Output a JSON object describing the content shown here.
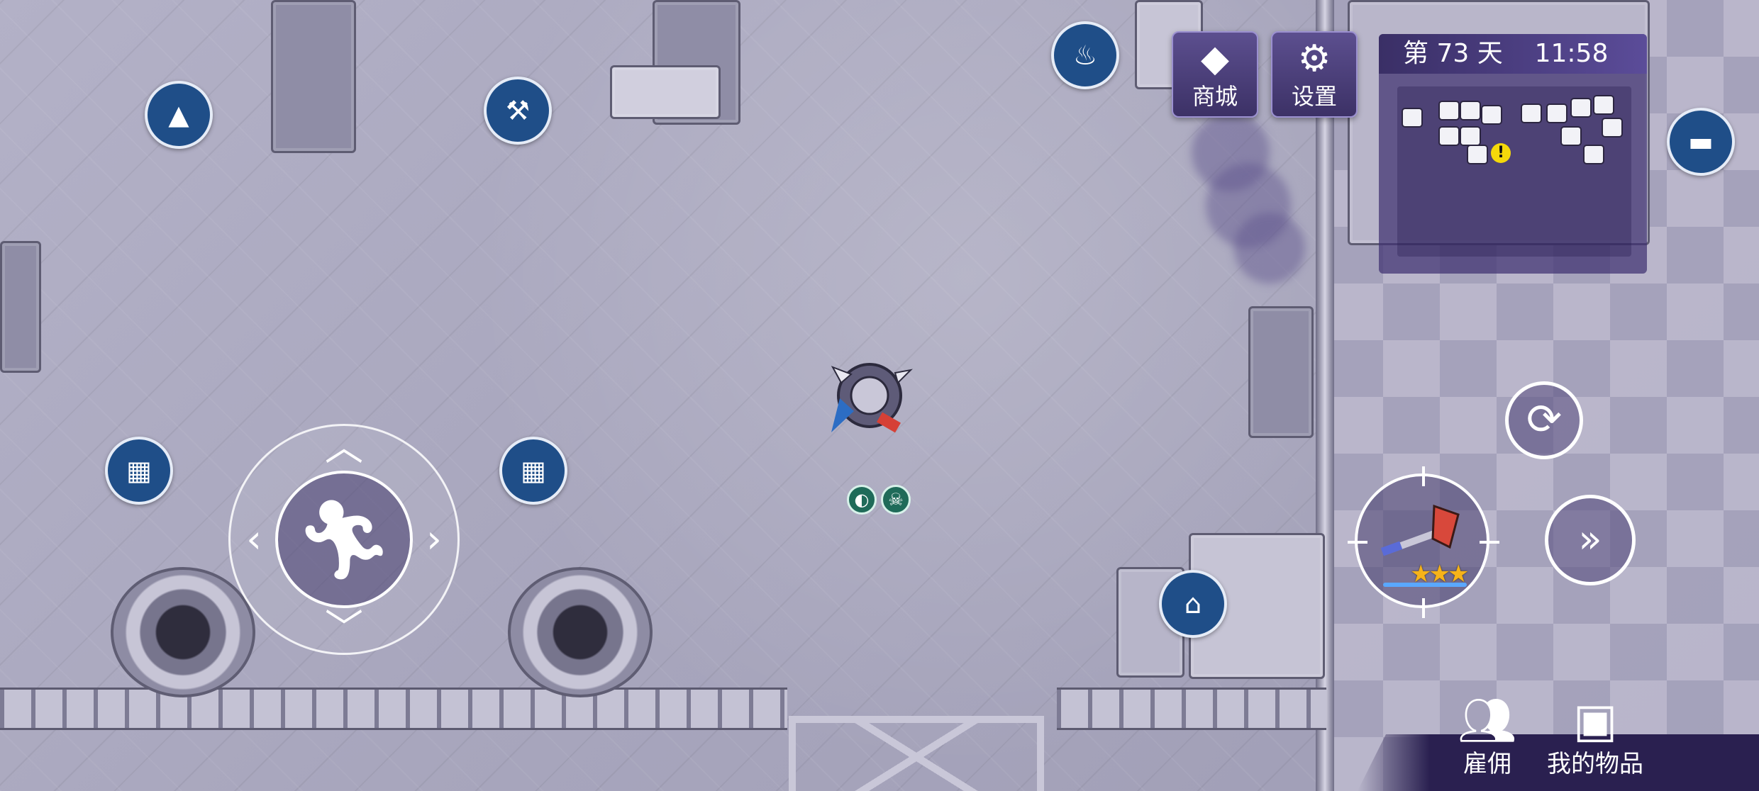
{
  "hud": {
    "day_label": "第 73 天",
    "time": "11:58",
    "shop_button": {
      "label": "商城",
      "icon": "diamond-icon"
    },
    "settings_button": {
      "label": "设置",
      "icon": "gear-icon"
    }
  },
  "world_icons": [
    {
      "name": "furnace-station-icon",
      "glyph": "▲"
    },
    {
      "name": "saw-workbench-icon",
      "glyph": "⚒"
    },
    {
      "name": "campfire-icon",
      "glyph": "♨"
    },
    {
      "name": "bed-icon",
      "glyph": "▬"
    },
    {
      "name": "stove-left-icon",
      "glyph": "▦"
    },
    {
      "name": "stove-right-icon",
      "glyph": "▦"
    },
    {
      "name": "doghouse-icon",
      "glyph": "⌂"
    }
  ],
  "controls": {
    "joystick_icon": "running-man-icon",
    "swap_icon": "refresh-icon",
    "sprint_icon": "dash-icon",
    "weapon": {
      "name": "fire-axe",
      "stars": "★★★"
    }
  },
  "player_status": [
    {
      "name": "stomach-status-icon",
      "glyph": "◐"
    },
    {
      "name": "skull-status-icon",
      "glyph": "☠"
    }
  ],
  "bottom_menu": {
    "hire_label": "雇佣",
    "inventory_label": "我的物品"
  },
  "colors": {
    "hud_purple": "#3c3166",
    "icon_blue": "#1f4e88",
    "star_gold": "#f6b319",
    "alert_yellow": "#f5d90a"
  }
}
